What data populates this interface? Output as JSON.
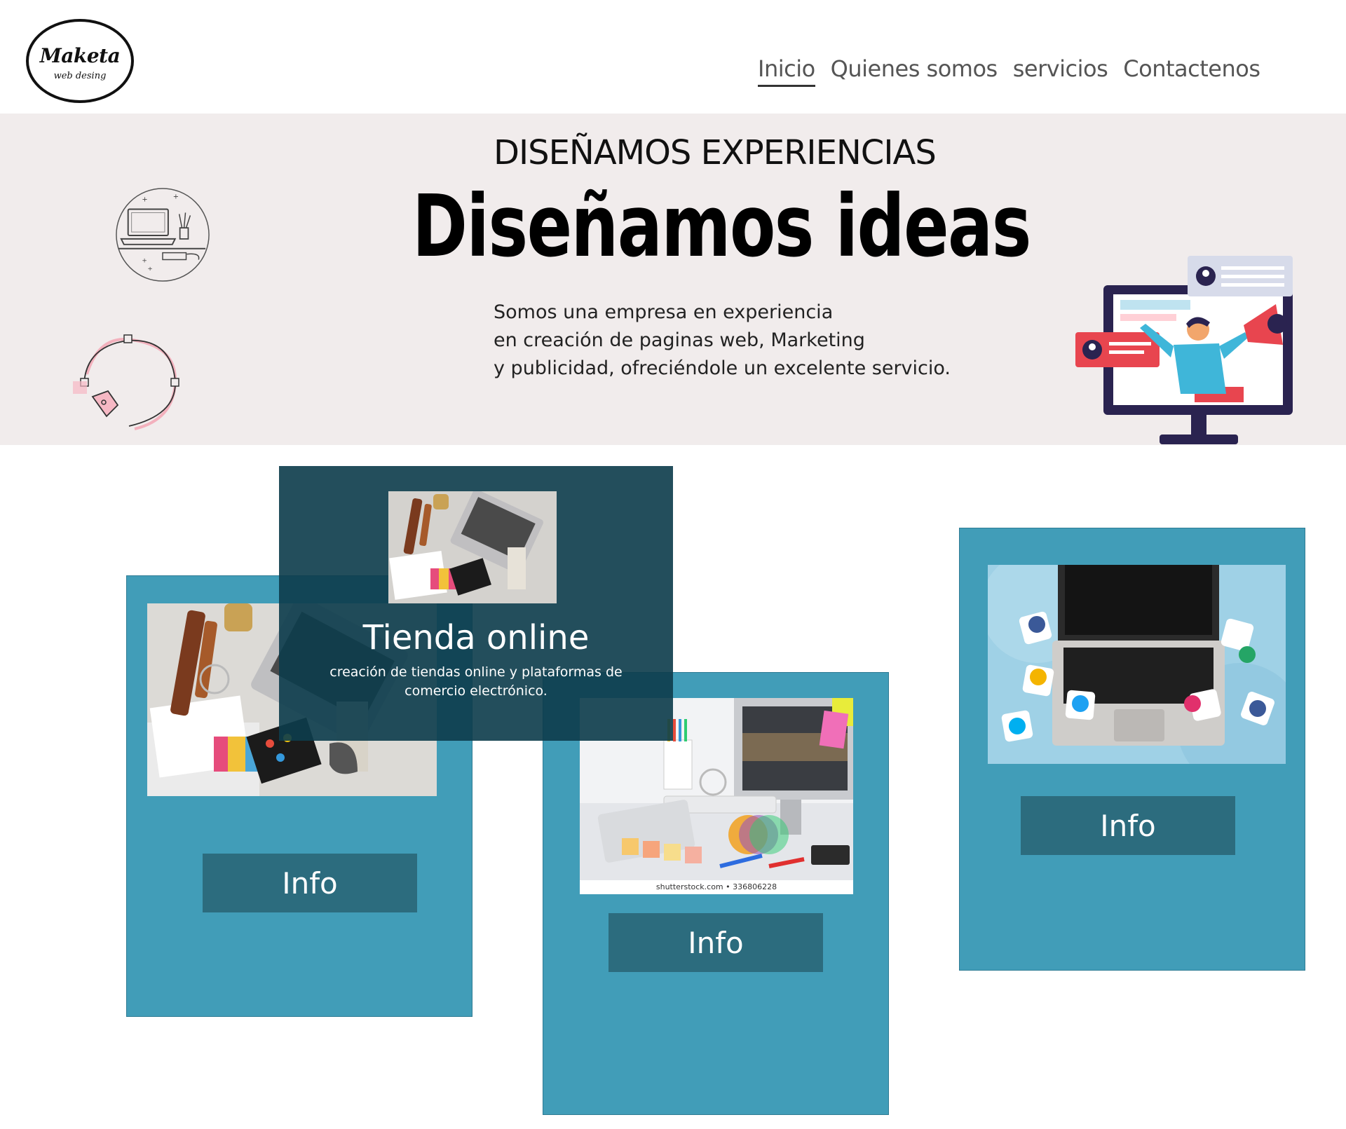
{
  "logo": {
    "title": "Maketa",
    "subtitle": "web desing"
  },
  "nav": {
    "items": [
      {
        "label": "Inicio",
        "active": true
      },
      {
        "label": "Quienes somos",
        "active": false
      },
      {
        "label": "servicios",
        "active": false
      },
      {
        "label": "Contactenos",
        "active": false
      }
    ]
  },
  "hero": {
    "kicker": "DISEÑAMOS EXPERIENCIAS",
    "title": "Diseñamos  ideas",
    "text_lines": [
      "Somos una empresa en experiencia",
      "en creación  de paginas web, Marketing",
      "y publicidad, ofreciéndole un  excelente servicio."
    ],
    "background": "#f1ecec"
  },
  "overlay": {
    "title": "Tienda online",
    "description": "creación de tiendas online y plataformas de comercio electrónico."
  },
  "cards": [
    {
      "button_label": "Info",
      "image": "desk-flatlay-photo"
    },
    {
      "button_label": "Info",
      "image": "designer-workspace-photo",
      "watermark": "shutterstock.com • 336806228"
    },
    {
      "button_label": "Info",
      "image": "laptop-social-media-photo"
    }
  ],
  "colors": {
    "card": "#419db8",
    "button": "#2c6c7e",
    "overlay": "#0d3c4c",
    "text_dark": "#111111"
  }
}
